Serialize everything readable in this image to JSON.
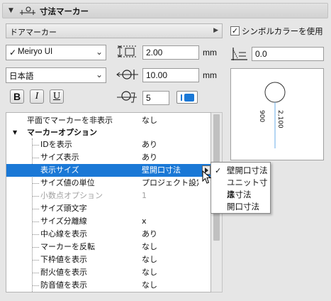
{
  "panel": {
    "title": "寸法マーカー"
  },
  "marker_type": {
    "value": "ドアマーカー"
  },
  "symbol_color": {
    "checked": true,
    "label": "シンボルカラーを使用"
  },
  "font": {
    "name": "Meiryo UI",
    "checked": "✓"
  },
  "language": {
    "value": "日本語"
  },
  "text_style": {
    "bold": "B",
    "italic": "I",
    "underline": "U"
  },
  "fields": {
    "height": {
      "value": "2.00",
      "unit": "mm"
    },
    "offset": {
      "value": "10.00",
      "unit": "mm"
    },
    "pen": {
      "value": "5"
    },
    "angle": {
      "value": "0.0"
    }
  },
  "preview": {
    "label1": "900",
    "label2": "2,100"
  },
  "properties": [
    {
      "name": "平面でマーカーを非表示",
      "value": "なし",
      "level": 0
    },
    {
      "name": "マーカーオプション",
      "value": "",
      "level": 0,
      "group": true
    },
    {
      "name": "IDを表示",
      "value": "あり",
      "level": 1
    },
    {
      "name": "サイズ表示",
      "value": "あり",
      "level": 1
    },
    {
      "name": "表示サイズ",
      "value": "壁開口寸法",
      "level": 1,
      "selected": true
    },
    {
      "name": "サイズ値の単位",
      "value": "プロジェクト設定に",
      "level": 1
    },
    {
      "name": "小数点オプション",
      "value": "1",
      "level": 1,
      "disabled": true
    },
    {
      "name": "サイズ頭文字",
      "value": "",
      "level": 1
    },
    {
      "name": "サイズ分離線",
      "value": "x",
      "level": 1
    },
    {
      "name": "中心線を表示",
      "value": "あり",
      "level": 1
    },
    {
      "name": "マーカーを反転",
      "value": "なし",
      "level": 1
    },
    {
      "name": "下枠値を表示",
      "value": "なし",
      "level": 1
    },
    {
      "name": "耐火値を表示",
      "value": "なし",
      "level": 1
    },
    {
      "name": "防音値を表示",
      "value": "なし",
      "level": 1
    }
  ],
  "popup": {
    "items": [
      {
        "label": "壁開口寸法",
        "checked": true
      },
      {
        "label": "ユニット寸法",
        "checked": false
      },
      {
        "label": "扉寸法",
        "checked": false
      },
      {
        "label": "開口寸法",
        "checked": false
      }
    ],
    "check_glyph": "✓"
  }
}
